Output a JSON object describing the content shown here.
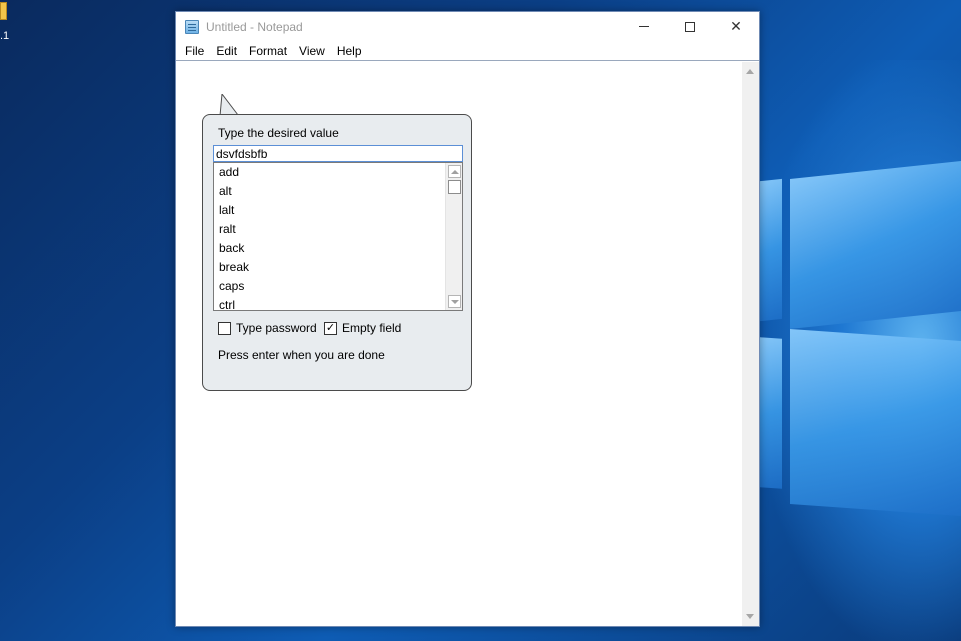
{
  "desktop": {
    "icon_label": ".1",
    "icon_name": "folder-icon"
  },
  "window": {
    "title": "Untitled - Notepad",
    "app_icon": "notepad-icon",
    "caption": {
      "minimize_icon": "minimize-icon",
      "maximize_icon": "maximize-icon",
      "close_icon": "close-icon",
      "close_glyph": "✕"
    },
    "menu": [
      "File",
      "Edit",
      "Format",
      "View",
      "Help"
    ]
  },
  "dialog": {
    "prompt": "Type the desired value",
    "input_value": "dsvfdsbfb",
    "list_items": [
      "add",
      "alt",
      "lalt",
      "ralt",
      "back",
      "break",
      "caps",
      "ctrl"
    ],
    "type_password": {
      "label": "Type password",
      "checked": false
    },
    "empty_field": {
      "label": "Empty field",
      "checked": true,
      "glyph": "✓"
    },
    "hint": "Press enter when you are done"
  },
  "colors": {
    "input_border": "#5b8fd6",
    "balloon_bg": "#e8ecef",
    "window_border": "#6f8ab4"
  }
}
